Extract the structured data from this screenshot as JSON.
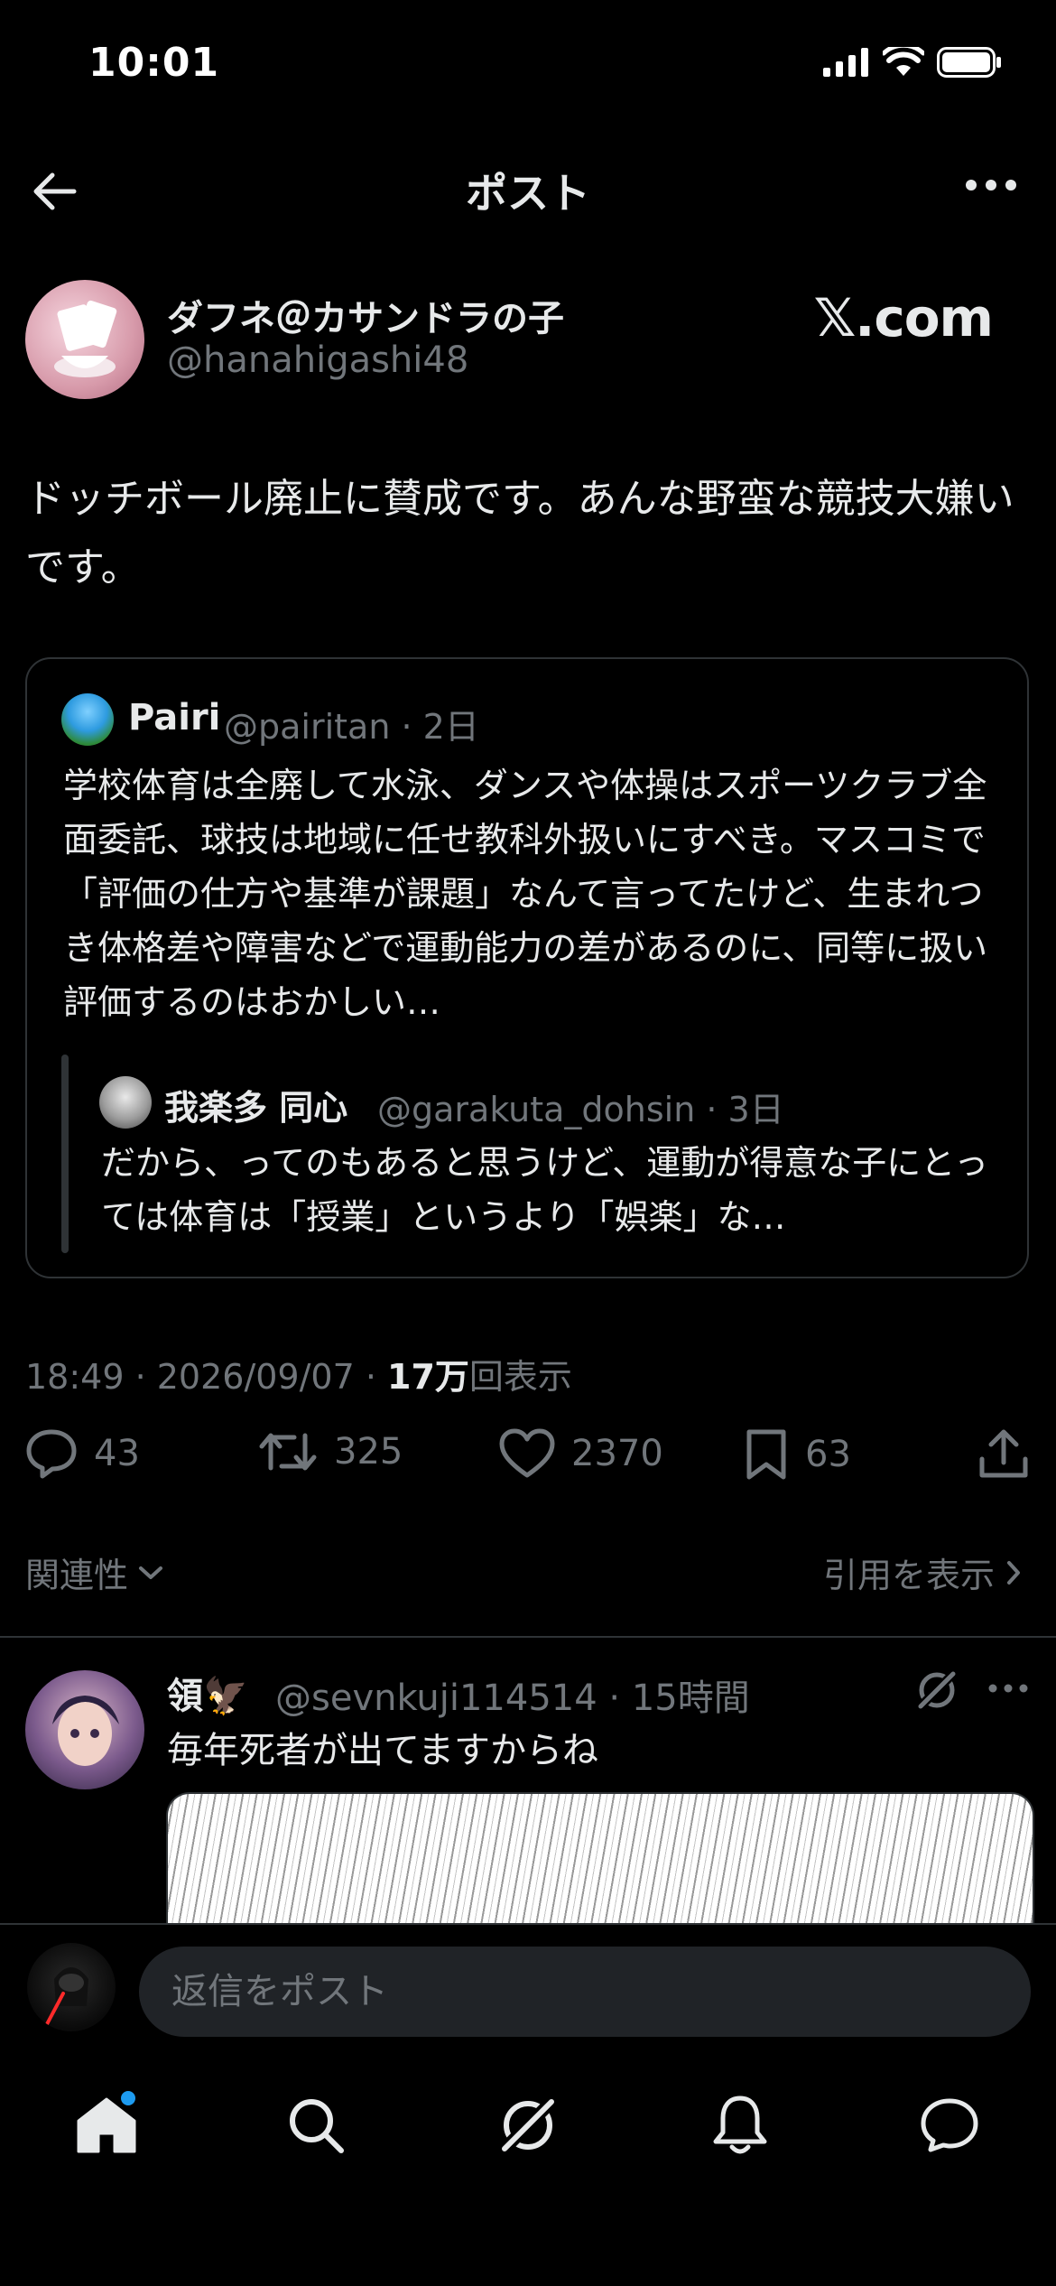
{
  "status_bar": {
    "time": "10:01"
  },
  "header": {
    "title": "ポスト"
  },
  "author": {
    "name": "ダフネ＠カサンドラの子",
    "handle": "@hanahigashi48",
    "badge": "𝕏.com"
  },
  "post": {
    "text": "ドッチボール廃止に賛成です。あんな野蛮な競技大嫌いです。",
    "timestamp_prefix": "18:49 · 2026/09/07 · ",
    "views_count": "17万",
    "views_label": "回表示"
  },
  "quote": {
    "name": "Pairi",
    "meta": "@pairitan · 2日",
    "text": "学校体育は全廃して水泳、ダンスや体操はスポーツクラブ全面委託、球技は地域に任せ教科外扱いにすべき。マスコミで「評価の仕方や基準が課題」なんて言ってたけど、生まれつき体格差や障害などで運動能力の差があるのに、同等に扱い評価するのはおかしい…",
    "nested": {
      "name": "我楽多 同心",
      "meta": "@garakuta_dohsin · 3日",
      "text": "だから、ってのもあると思うけど、運動が得意な子にとっては体育は「授業」というより「娯楽」な…"
    }
  },
  "actions": {
    "replies": "43",
    "reposts": "325",
    "likes": "2370",
    "bookmarks": "63"
  },
  "sort": {
    "label": "関連性",
    "quotes_link": "引用を表示"
  },
  "reply": {
    "name": "領🦅",
    "meta": "@sevnkuji114514 · 15時間",
    "text": "毎年死者が出てますからね"
  },
  "composer": {
    "placeholder": "返信をポスト"
  },
  "icons": [
    "back-arrow-icon",
    "more-icon",
    "reply-icon",
    "repost-icon",
    "like-icon",
    "bookmark-icon",
    "share-icon",
    "chevron-down-icon",
    "chevron-right-icon",
    "grok-icon",
    "home-icon",
    "search-icon",
    "notifications-icon",
    "messages-icon"
  ],
  "colors": {
    "background": "#000000",
    "text": "#e7e9ea",
    "muted": "#71767b",
    "accent": "#1d9bf0",
    "border": "#2f3336"
  }
}
